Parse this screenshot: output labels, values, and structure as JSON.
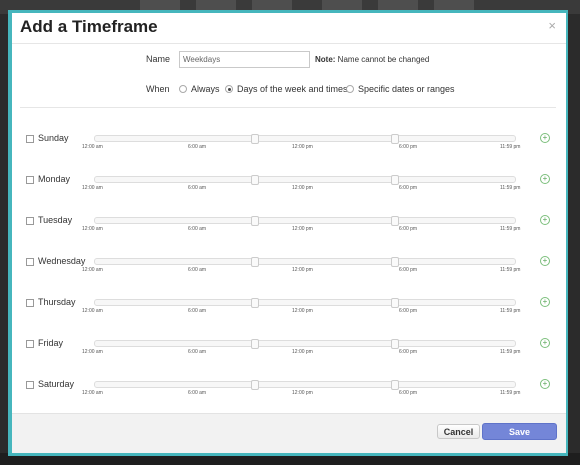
{
  "dialog": {
    "title": "Add a Timeframe",
    "close_glyph": "×"
  },
  "form": {
    "name_label": "Name",
    "name_value": "Weekdays",
    "note_bold": "Note:",
    "note_text": " Name cannot be changed",
    "when_label": "When",
    "options": [
      "Always",
      "Days of the week and times",
      "Specific dates or ranges"
    ],
    "selected_option": "Days of the week and times"
  },
  "days": [
    "Sunday",
    "Monday",
    "Tuesday",
    "Wednesday",
    "Thursday",
    "Friday",
    "Saturday"
  ],
  "ticks": [
    "12:00 am",
    "6:00 am",
    "12:00 pm",
    "6:00 pm",
    "11:59 pm"
  ],
  "footer": {
    "cancel_label": "Cancel",
    "save_label": "Save"
  },
  "icons": {
    "add": "plus-circle-icon",
    "close": "close-icon"
  },
  "colors": {
    "frame": "#46b6bd",
    "save": "#7486d8",
    "add": "#5aa55a"
  }
}
